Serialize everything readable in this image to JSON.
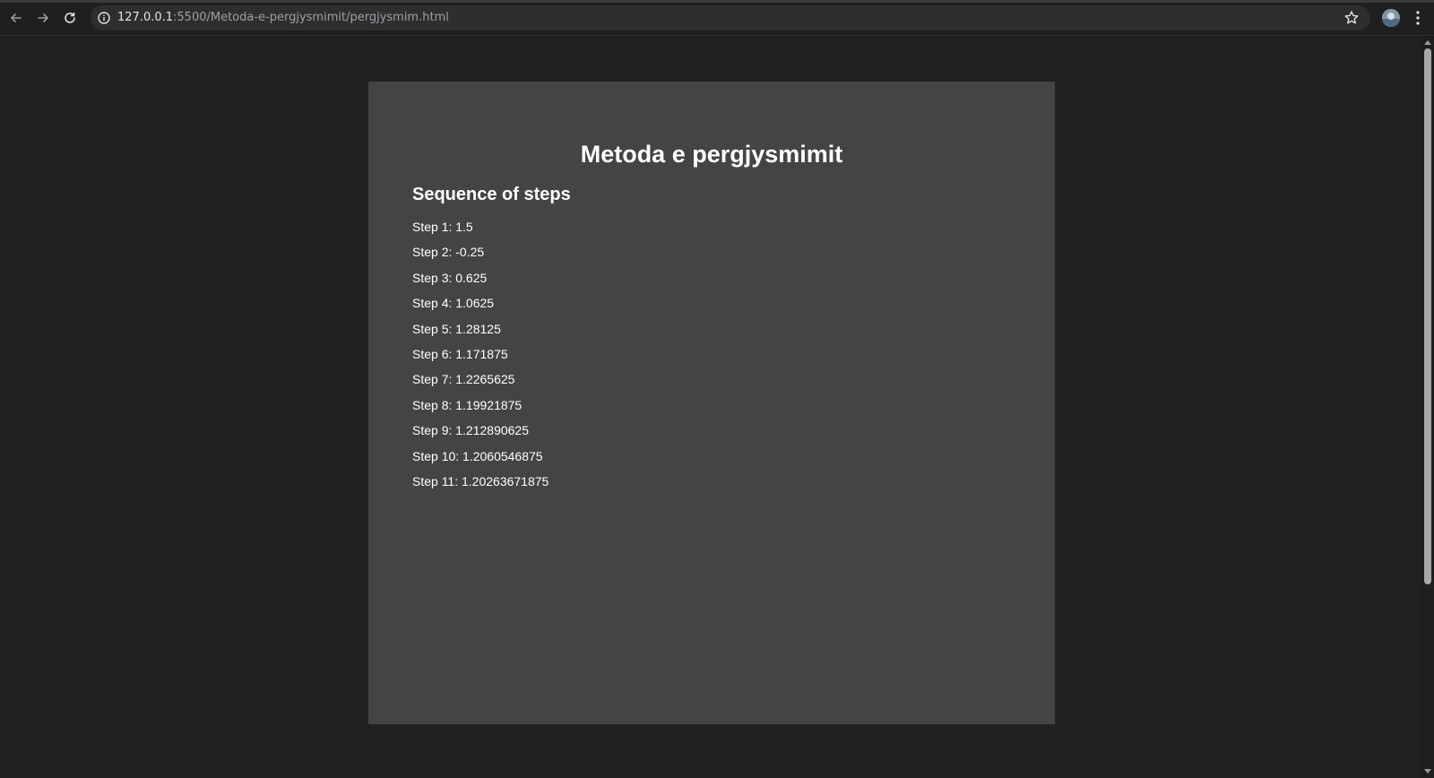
{
  "browser": {
    "url_host": "127.0.0.1",
    "url_path": ":5500/Metoda-e-pergjysmimit/pergjysmim.html"
  },
  "page": {
    "title": "Metoda e pergjysmimit",
    "section_title": "Sequence of steps",
    "steps": [
      "Step 1: 1.5",
      "Step 2: -0.25",
      "Step 3: 0.625",
      "Step 4: 1.0625",
      "Step 5: 1.28125",
      "Step 6: 1.171875",
      "Step 7: 1.2265625",
      "Step 8: 1.19921875",
      "Step 9: 1.212890625",
      "Step 10: 1.2060546875",
      "Step 11: 1.20263671875"
    ]
  },
  "icons": {
    "back": "arrow-left-icon",
    "forward": "arrow-right-icon",
    "reload": "reload-icon",
    "info": "info-icon",
    "bookmark": "star-icon",
    "profile": "avatar",
    "menu": "kebab-menu-icon"
  },
  "colors": {
    "page_background": "#212121",
    "card_background": "#444444",
    "text": "#ffffff"
  }
}
